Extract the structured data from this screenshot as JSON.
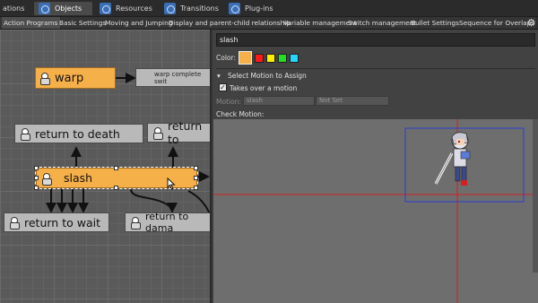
{
  "main_tabs": [
    {
      "label": "ations",
      "active": false,
      "icon": "none"
    },
    {
      "label": "Objects",
      "active": true,
      "icon": "objects-icon"
    },
    {
      "label": "Resources",
      "active": false,
      "icon": "resources-icon"
    },
    {
      "label": "Transitions",
      "active": false,
      "icon": "transitions-icon"
    },
    {
      "label": "Plug-ins",
      "active": false,
      "icon": "plugins-icon"
    }
  ],
  "sub_tabs": [
    "Action Programs",
    "Basic Settings",
    "Moving and Jumping",
    "Display and parent-child relationship",
    "Variable management",
    "Switch management",
    "Bullet Settings",
    "Sequence for Overlaps"
  ],
  "nodes": {
    "warp": "warp",
    "warp_complete": "warp complete swit",
    "return_to_death": "return to death",
    "return_to_top": "return to",
    "slash": "slash",
    "return_to_wait": "return to wait",
    "return_to_damage": "return to dama"
  },
  "panel": {
    "name_value": "slash",
    "color_label": "Color:",
    "colors": [
      "#f5b04a",
      "#ff1a1a",
      "#ffee00",
      "#22dd22",
      "#22d6ff"
    ],
    "selected_color": "#f5b04a",
    "select_motion_label": "Select Motion to Assign",
    "takes_over_label": "Takes over a motion",
    "takes_over_checked": true,
    "motion_label": "Motion:",
    "motion_value": "slash",
    "motion_second_value": "Not Set",
    "check_motion_label": "Check Motion:"
  },
  "colors": {
    "accent_orange": "#f5b04a",
    "crosshair_red": "#d22020",
    "selection_blue": "#2a3fd0"
  }
}
